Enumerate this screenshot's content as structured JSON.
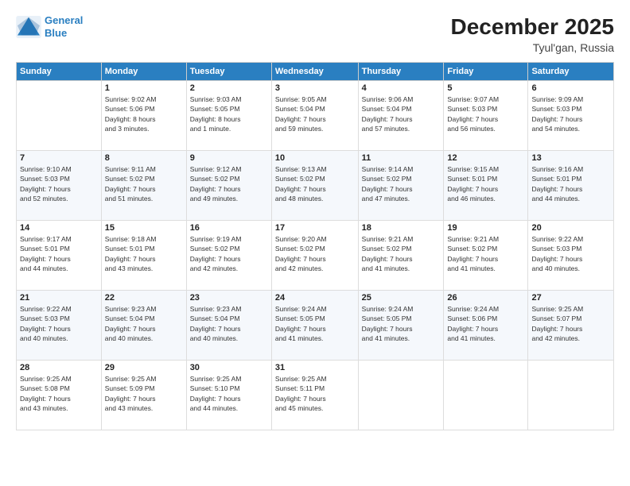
{
  "app": {
    "name": "GeneralBlue",
    "logo_line1": "General",
    "logo_line2": "Blue"
  },
  "calendar": {
    "month": "December 2025",
    "location": "Tyul'gan, Russia",
    "weekdays": [
      "Sunday",
      "Monday",
      "Tuesday",
      "Wednesday",
      "Thursday",
      "Friday",
      "Saturday"
    ],
    "weeks": [
      [
        {
          "day": "",
          "info": ""
        },
        {
          "day": "1",
          "info": "Sunrise: 9:02 AM\nSunset: 5:06 PM\nDaylight: 8 hours\nand 3 minutes."
        },
        {
          "day": "2",
          "info": "Sunrise: 9:03 AM\nSunset: 5:05 PM\nDaylight: 8 hours\nand 1 minute."
        },
        {
          "day": "3",
          "info": "Sunrise: 9:05 AM\nSunset: 5:04 PM\nDaylight: 7 hours\nand 59 minutes."
        },
        {
          "day": "4",
          "info": "Sunrise: 9:06 AM\nSunset: 5:04 PM\nDaylight: 7 hours\nand 57 minutes."
        },
        {
          "day": "5",
          "info": "Sunrise: 9:07 AM\nSunset: 5:03 PM\nDaylight: 7 hours\nand 56 minutes."
        },
        {
          "day": "6",
          "info": "Sunrise: 9:09 AM\nSunset: 5:03 PM\nDaylight: 7 hours\nand 54 minutes."
        }
      ],
      [
        {
          "day": "7",
          "info": "Sunrise: 9:10 AM\nSunset: 5:03 PM\nDaylight: 7 hours\nand 52 minutes."
        },
        {
          "day": "8",
          "info": "Sunrise: 9:11 AM\nSunset: 5:02 PM\nDaylight: 7 hours\nand 51 minutes."
        },
        {
          "day": "9",
          "info": "Sunrise: 9:12 AM\nSunset: 5:02 PM\nDaylight: 7 hours\nand 49 minutes."
        },
        {
          "day": "10",
          "info": "Sunrise: 9:13 AM\nSunset: 5:02 PM\nDaylight: 7 hours\nand 48 minutes."
        },
        {
          "day": "11",
          "info": "Sunrise: 9:14 AM\nSunset: 5:02 PM\nDaylight: 7 hours\nand 47 minutes."
        },
        {
          "day": "12",
          "info": "Sunrise: 9:15 AM\nSunset: 5:01 PM\nDaylight: 7 hours\nand 46 minutes."
        },
        {
          "day": "13",
          "info": "Sunrise: 9:16 AM\nSunset: 5:01 PM\nDaylight: 7 hours\nand 44 minutes."
        }
      ],
      [
        {
          "day": "14",
          "info": "Sunrise: 9:17 AM\nSunset: 5:01 PM\nDaylight: 7 hours\nand 44 minutes."
        },
        {
          "day": "15",
          "info": "Sunrise: 9:18 AM\nSunset: 5:01 PM\nDaylight: 7 hours\nand 43 minutes."
        },
        {
          "day": "16",
          "info": "Sunrise: 9:19 AM\nSunset: 5:02 PM\nDaylight: 7 hours\nand 42 minutes."
        },
        {
          "day": "17",
          "info": "Sunrise: 9:20 AM\nSunset: 5:02 PM\nDaylight: 7 hours\nand 42 minutes."
        },
        {
          "day": "18",
          "info": "Sunrise: 9:21 AM\nSunset: 5:02 PM\nDaylight: 7 hours\nand 41 minutes."
        },
        {
          "day": "19",
          "info": "Sunrise: 9:21 AM\nSunset: 5:02 PM\nDaylight: 7 hours\nand 41 minutes."
        },
        {
          "day": "20",
          "info": "Sunrise: 9:22 AM\nSunset: 5:03 PM\nDaylight: 7 hours\nand 40 minutes."
        }
      ],
      [
        {
          "day": "21",
          "info": "Sunrise: 9:22 AM\nSunset: 5:03 PM\nDaylight: 7 hours\nand 40 minutes."
        },
        {
          "day": "22",
          "info": "Sunrise: 9:23 AM\nSunset: 5:04 PM\nDaylight: 7 hours\nand 40 minutes."
        },
        {
          "day": "23",
          "info": "Sunrise: 9:23 AM\nSunset: 5:04 PM\nDaylight: 7 hours\nand 40 minutes."
        },
        {
          "day": "24",
          "info": "Sunrise: 9:24 AM\nSunset: 5:05 PM\nDaylight: 7 hours\nand 41 minutes."
        },
        {
          "day": "25",
          "info": "Sunrise: 9:24 AM\nSunset: 5:05 PM\nDaylight: 7 hours\nand 41 minutes."
        },
        {
          "day": "26",
          "info": "Sunrise: 9:24 AM\nSunset: 5:06 PM\nDaylight: 7 hours\nand 41 minutes."
        },
        {
          "day": "27",
          "info": "Sunrise: 9:25 AM\nSunset: 5:07 PM\nDaylight: 7 hours\nand 42 minutes."
        }
      ],
      [
        {
          "day": "28",
          "info": "Sunrise: 9:25 AM\nSunset: 5:08 PM\nDaylight: 7 hours\nand 43 minutes."
        },
        {
          "day": "29",
          "info": "Sunrise: 9:25 AM\nSunset: 5:09 PM\nDaylight: 7 hours\nand 43 minutes."
        },
        {
          "day": "30",
          "info": "Sunrise: 9:25 AM\nSunset: 5:10 PM\nDaylight: 7 hours\nand 44 minutes."
        },
        {
          "day": "31",
          "info": "Sunrise: 9:25 AM\nSunset: 5:11 PM\nDaylight: 7 hours\nand 45 minutes."
        },
        {
          "day": "",
          "info": ""
        },
        {
          "day": "",
          "info": ""
        },
        {
          "day": "",
          "info": ""
        }
      ]
    ]
  }
}
